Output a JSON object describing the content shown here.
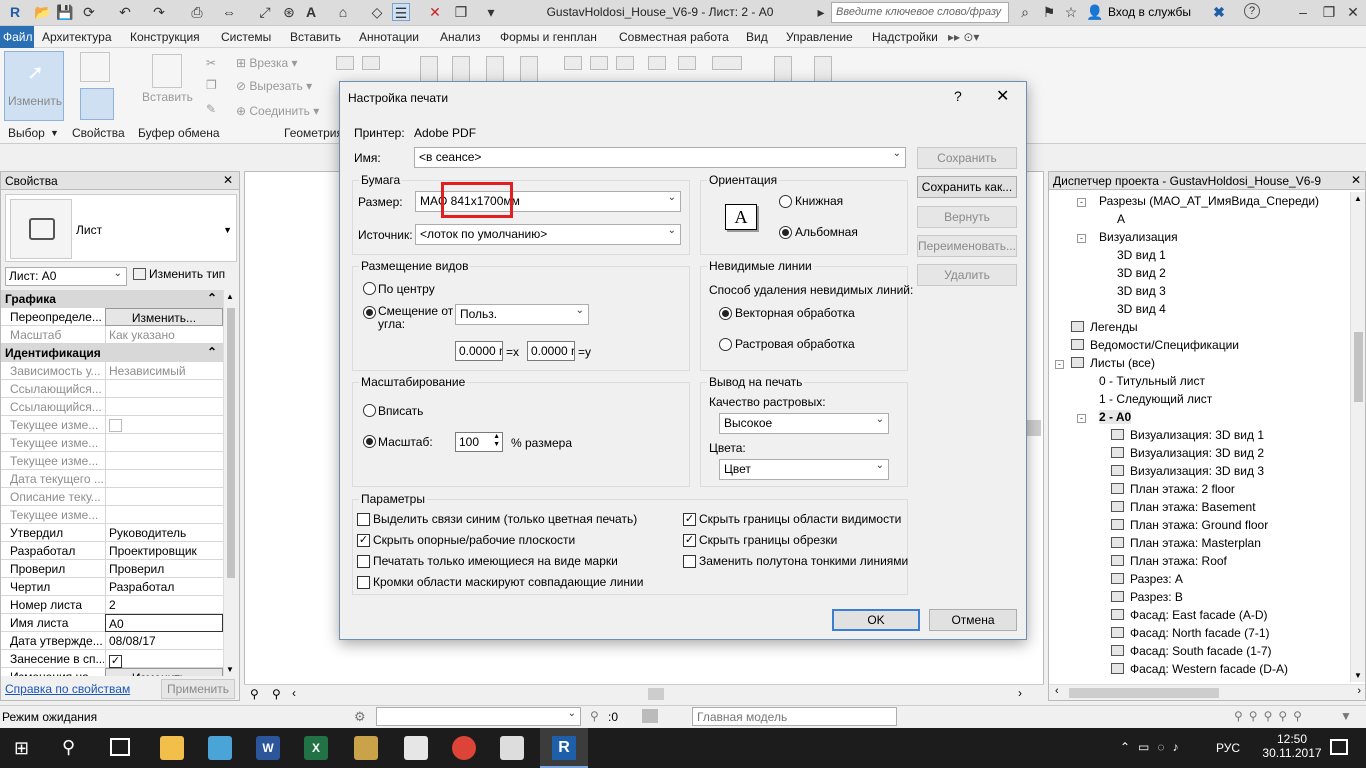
{
  "window": {
    "title": "GustavHoldosi_House_V6-9 - Лист: 2 - A0",
    "search_placeholder": "Введите ключевое слово/фразу",
    "signin": "Вход в службы"
  },
  "menu": [
    "Файл",
    "Архитектура",
    "Конструкция",
    "Системы",
    "Вставить",
    "Аннотации",
    "Анализ",
    "Формы и генплан",
    "Совместная работа",
    "Вид",
    "Управление",
    "Надстройки"
  ],
  "ribbon": {
    "modify": "Изменить",
    "select": "Выбор",
    "properties": "Свойства",
    "insert": "Вставить",
    "clipboard": "Буфер обмена",
    "geometry": "Геометрия",
    "cope": "Врезка",
    "cut": "Вырезать",
    "join": "Соединить"
  },
  "props": {
    "title": "Свойства",
    "type": "Лист",
    "instance": "Лист: A0",
    "edit_type": "Изменить тип",
    "sections": {
      "graphics": "Графика",
      "identity": "Идентификация"
    },
    "rows": [
      {
        "k": "Переопределе...",
        "v": "Изменить...",
        "btn": true
      },
      {
        "k": "Масштаб",
        "v": "Как указано",
        "muted": true
      },
      {
        "k": "Зависимость у...",
        "v": "Независимый",
        "muted": true
      },
      {
        "k": "Ссылающийся...",
        "v": "",
        "muted": true
      },
      {
        "k": "Ссылающийся...",
        "v": "",
        "muted": true
      },
      {
        "k": "Текущее изме...",
        "v": "",
        "muted": true,
        "chk": true
      },
      {
        "k": "Текущее изме...",
        "v": "",
        "muted": true
      },
      {
        "k": "Текущее изме...",
        "v": "",
        "muted": true
      },
      {
        "k": "Дата текущего ...",
        "v": "",
        "muted": true
      },
      {
        "k": "Описание теку...",
        "v": "",
        "muted": true
      },
      {
        "k": "Текущее изме...",
        "v": "",
        "muted": true
      },
      {
        "k": "Утвердил",
        "v": "Руководитель"
      },
      {
        "k": "Разработал",
        "v": "Проектировщик"
      },
      {
        "k": "Проверил",
        "v": "Проверил"
      },
      {
        "k": "Чертил",
        "v": "Разработал"
      },
      {
        "k": "Номер листа",
        "v": "2"
      },
      {
        "k": "Имя листа",
        "v": "A0",
        "edit": true
      },
      {
        "k": "Дата утвержде...",
        "v": "08/08/17"
      },
      {
        "k": "Занесение в сп...",
        "v": "",
        "chk": true,
        "checked": true
      },
      {
        "k": "Изменения на ...",
        "v": "Изменить...",
        "btn": true
      }
    ],
    "help": "Справка по свойствам",
    "apply": "Применить"
  },
  "browser": {
    "title": "Диспетчер проекта - GustavHoldosi_House_V6-9",
    "items": [
      {
        "t": "Разрезы (МАО_АТ_ИмяВида_Спереди)",
        "lvl": 1,
        "exp": "-"
      },
      {
        "t": "A",
        "lvl": 2
      },
      {
        "t": "Визуализация",
        "lvl": 1,
        "exp": "-"
      },
      {
        "t": "3D вид 1",
        "lvl": 2
      },
      {
        "t": "3D вид 2",
        "lvl": 2
      },
      {
        "t": "3D вид 3",
        "lvl": 2
      },
      {
        "t": "3D вид 4",
        "lvl": 2
      },
      {
        "t": "Легенды",
        "lvl": 0,
        "icon": true
      },
      {
        "t": "Ведомости/Спецификации",
        "lvl": 0,
        "icon": true
      },
      {
        "t": "Листы (все)",
        "lvl": 0,
        "icon": true,
        "exp": "-"
      },
      {
        "t": "0 - Титульный лист",
        "lvl": 1
      },
      {
        "t": "1 - Следующий лист",
        "lvl": 1
      },
      {
        "t": "2 - A0",
        "lvl": 1,
        "exp": "-",
        "bold": true
      },
      {
        "t": "Визуализация: 3D вид 1",
        "lvl": 2,
        "icon": true
      },
      {
        "t": "Визуализация: 3D вид 2",
        "lvl": 2,
        "icon": true
      },
      {
        "t": "Визуализация: 3D вид 3",
        "lvl": 2,
        "icon": true
      },
      {
        "t": "План этажа: 2 floor",
        "lvl": 2,
        "icon": true
      },
      {
        "t": "План этажа: Basement",
        "lvl": 2,
        "icon": true
      },
      {
        "t": "План этажа: Ground floor",
        "lvl": 2,
        "icon": true
      },
      {
        "t": "План этажа: Masterplan",
        "lvl": 2,
        "icon": true
      },
      {
        "t": "План этажа: Roof",
        "lvl": 2,
        "icon": true
      },
      {
        "t": "Разрез: A",
        "lvl": 2,
        "icon": true
      },
      {
        "t": "Разрез: B",
        "lvl": 2,
        "icon": true
      },
      {
        "t": "Фасад: East facade (A-D)",
        "lvl": 2,
        "icon": true
      },
      {
        "t": "Фасад: North facade (7-1)",
        "lvl": 2,
        "icon": true
      },
      {
        "t": "Фасад: South facade (1-7)",
        "lvl": 2,
        "icon": true
      },
      {
        "t": "Фасад: Western facade (D-A)",
        "lvl": 2,
        "icon": true
      }
    ]
  },
  "status": {
    "text": "Режим ожидания",
    "zero": ":0",
    "model": "Главная модель"
  },
  "taskbar": {
    "lang": "РУС",
    "time": "12:50",
    "date": "30.11.2017"
  },
  "dialog": {
    "title": "Настройка печати",
    "help": "?",
    "printer_label": "Принтер:",
    "printer": "Adobe PDF",
    "name_label": "Имя:",
    "name": "<в сеансе>",
    "paper": "Бумага",
    "size_label": "Размер:",
    "size": "MAO 841x1700мм",
    "source_label": "Источник:",
    "source": "<лоток по умолчанию>",
    "orientation": "Ориентация",
    "portrait": "Книжная",
    "landscape": "Альбомная",
    "placement": "Размещение видов",
    "center": "По центру",
    "offset": "Смещение от угла:",
    "offset_mode": "Польз.",
    "x_val": "0.0000 r",
    "x_lbl": "=x",
    "y_val": "0.0000 r",
    "y_lbl": "=y",
    "hidden": "Невидимые линии",
    "hidden_method": "Способ удаления невидимых линий:",
    "vector": "Векторная обработка",
    "raster": "Растровая обработка",
    "zoom": "Масштабирование",
    "fit": "Вписать",
    "scale": "Масштаб:",
    "scale_val": "100",
    "scale_unit": "% размера",
    "output": "Вывод на печать",
    "raster_quality": "Качество растровых:",
    "quality": "Высокое",
    "colors": "Цвета:",
    "color": "Цвет",
    "options": "Параметры",
    "opts": [
      {
        "t": "Выделить связи синим (только цветная печать)",
        "c": false
      },
      {
        "t": "Скрыть опорные/рабочие плоскости",
        "c": true
      },
      {
        "t": "Печатать только имеющиеся на виде марки",
        "c": false
      },
      {
        "t": "Кромки области маскируют совпадающие линии",
        "c": false
      },
      {
        "t": "Скрыть границы области видимости",
        "c": true
      },
      {
        "t": "Скрыть границы обрезки",
        "c": true
      },
      {
        "t": "Заменить полутона тонкими линиями",
        "c": false
      }
    ],
    "buttons": {
      "save": "Сохранить",
      "save_as": "Сохранить как...",
      "revert": "Вернуть",
      "rename": "Переименовать...",
      "delete": "Удалить",
      "ok": "OK",
      "cancel": "Отмена"
    }
  },
  "colors": {
    "accent": "#2a6fb3",
    "highlight": "#e02020"
  }
}
